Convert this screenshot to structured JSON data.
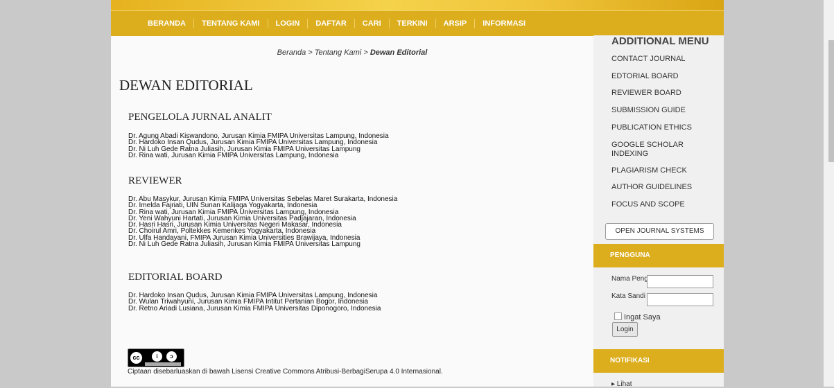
{
  "nav": {
    "items": [
      "BERANDA",
      "TENTANG KAMI",
      "LOGIN",
      "DAFTAR",
      "CARI",
      "TERKINI",
      "ARSIP",
      "INFORMASI"
    ]
  },
  "breadcrumb": {
    "home": "Beranda",
    "sep1": " > ",
    "parent": "Tentang Kami",
    "sep2": " > ",
    "current": "Dewan Editorial"
  },
  "main": {
    "title": "DEWAN EDITORIAL",
    "sections": [
      {
        "heading": "PENGELOLA JURNAL ANALIT",
        "people": [
          "Dr. Agung Abadi Kiswandono, Jurusan Kimia FMIPA Universitas Lampung, Indonesia",
          "Dr. Hardoko Insan Qudus, Jurusan Kimia FMIPA Universitas Lampung, Indonesia",
          "Dr. Ni Luh Gede Ratna Juliasih, Jurusan Kimia FMIPA Universitas Lampung",
          "Dr. Rina wati, Jurusan Kimia FMIPA Universitas Lampung, Indonesia"
        ]
      },
      {
        "heading": "REVIEWER",
        "people": [
          "Dr. Abu Masykur, Jurusan Kimia FMIPA Universitas Sebelas Maret Surakarta, Indonesia",
          "Dr. Imelda Fajriati, UIN Sunan Kalijaga Yogyakarta, Indonesia",
          "Dr. Rina wati, Jurusan Kimia FMIPA Universitas Lampung, Indonesia",
          "Dr. Yeni Wahyuni Hartati, Jurusan Kimia Universitas Padjajaran, Indonesia",
          "Dr. Hasri Hasri, Jurusan Kimia Universitas Negeri Makasar, Indonesia",
          "Dr. Choirul Amri, Poltekkes Kemenkes Yogyakarta, Indonesia",
          "Dr. Ulfa Handayani, FMIPA Jurusan Kimia Universities Brawijaya, Indonesia",
          "Dr. Ni Luh Gede Ratna Juliasih, Jurusan Kimia FMIPA Universitas Lampung"
        ]
      },
      {
        "heading": "EDITORIAL BOARD",
        "people": [
          "Dr. Hardoko Insan Qudus, Jurusan Kimia FMIPA Universitas Lampung, Indonesia",
          "Dr. Wulan Triwahyuni, Jurusan Kimia FMIPA Intitut Pertanian Bogor, Indonesia",
          "Dr. Retno Ariadi Lusiana, Jurusan Kimia FMIPA Universitas Diponogoro, Indonesia"
        ]
      }
    ],
    "license": {
      "badge_cc": "cc",
      "badge_by": "i",
      "badge_sa": "ↄ",
      "text": "Ciptaan disebarluaskan di bawah Lisensi Creative Commons Atribusi-BerbagiSerupa 4.0 Internasional."
    }
  },
  "sidebar": {
    "additional_menu_title": "ADDITIONAL MENU",
    "menu": [
      "CONTACT JOURNAL",
      "EDTORIAL BOARD",
      "REVIEWER BOARD",
      "SUBMISSION GUIDE",
      "PUBLICATION ETHICS",
      "GOOGLE SCHOLAR INDEXING",
      "PLAGIARISM CHECK",
      "AUTHOR GUIDELINES",
      "FOCUS AND SCOPE"
    ],
    "ojs_button": "OPEN JOURNAL SYSTEMS",
    "user_block": {
      "title": "PENGGUNA",
      "username_label": "Nama Pengguna",
      "password_label": "Kata Sandi",
      "remember_label": "Ingat Saya",
      "login_button": "Login"
    },
    "notif_block": {
      "title": "NOTIFIKASI",
      "link": "▸ Lihat"
    }
  }
}
